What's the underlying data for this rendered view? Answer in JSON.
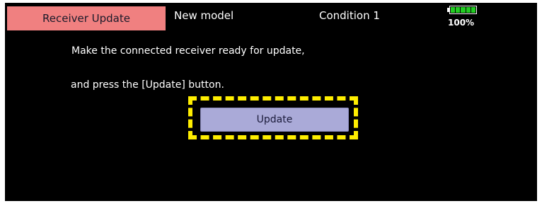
{
  "header": {
    "screen_title": "Receiver Update",
    "model_name": "New model",
    "condition": "Condition 1",
    "battery": {
      "level_text": "100%",
      "level_fraction": 1.0,
      "color": "#22cc22"
    }
  },
  "main": {
    "instruction_line_1": "Make the connected receiver ready for update,",
    "instruction_line_2": "and press the [Update] button.",
    "update_button_label": "Update"
  },
  "colors": {
    "background": "#000000",
    "title_tab": "#f08080",
    "button": "#aaaad8",
    "highlight": "#ffee00"
  }
}
